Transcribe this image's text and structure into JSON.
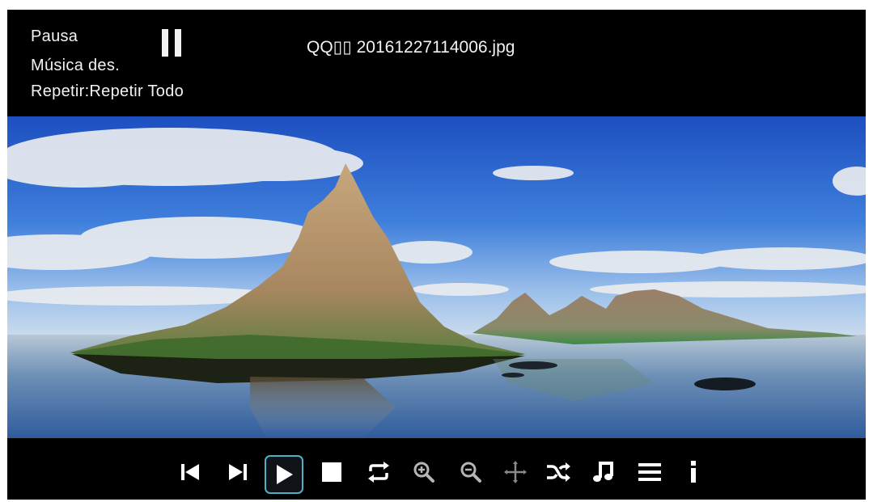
{
  "status": {
    "playback_state": "Pausa",
    "music_state": "Música des.",
    "repeat_state": "Repetir:Repetir Todo"
  },
  "file": {
    "name": "QQ▯▯ 20161227114006.jpg"
  },
  "controls": [
    {
      "name": "previous",
      "icon": "skip-previous-icon"
    },
    {
      "name": "next",
      "icon": "skip-next-icon"
    },
    {
      "name": "play",
      "icon": "play-icon",
      "selected": true
    },
    {
      "name": "stop",
      "icon": "stop-icon"
    },
    {
      "name": "repeat",
      "icon": "repeat-icon"
    },
    {
      "name": "zoom-in",
      "icon": "zoom-in-icon"
    },
    {
      "name": "zoom-out",
      "icon": "zoom-out-icon"
    },
    {
      "name": "move",
      "icon": "move-icon"
    },
    {
      "name": "shuffle",
      "icon": "shuffle-icon"
    },
    {
      "name": "music",
      "icon": "music-note-icon"
    },
    {
      "name": "playlist",
      "icon": "playlist-icon"
    },
    {
      "name": "info",
      "icon": "info-icon"
    }
  ],
  "colors": {
    "bar_background": "#000000",
    "text": "#f2f2f2",
    "selection_border": "#4fb2c2",
    "icon_active": "#ffffff",
    "icon_disabled": "#8a8a8a"
  }
}
